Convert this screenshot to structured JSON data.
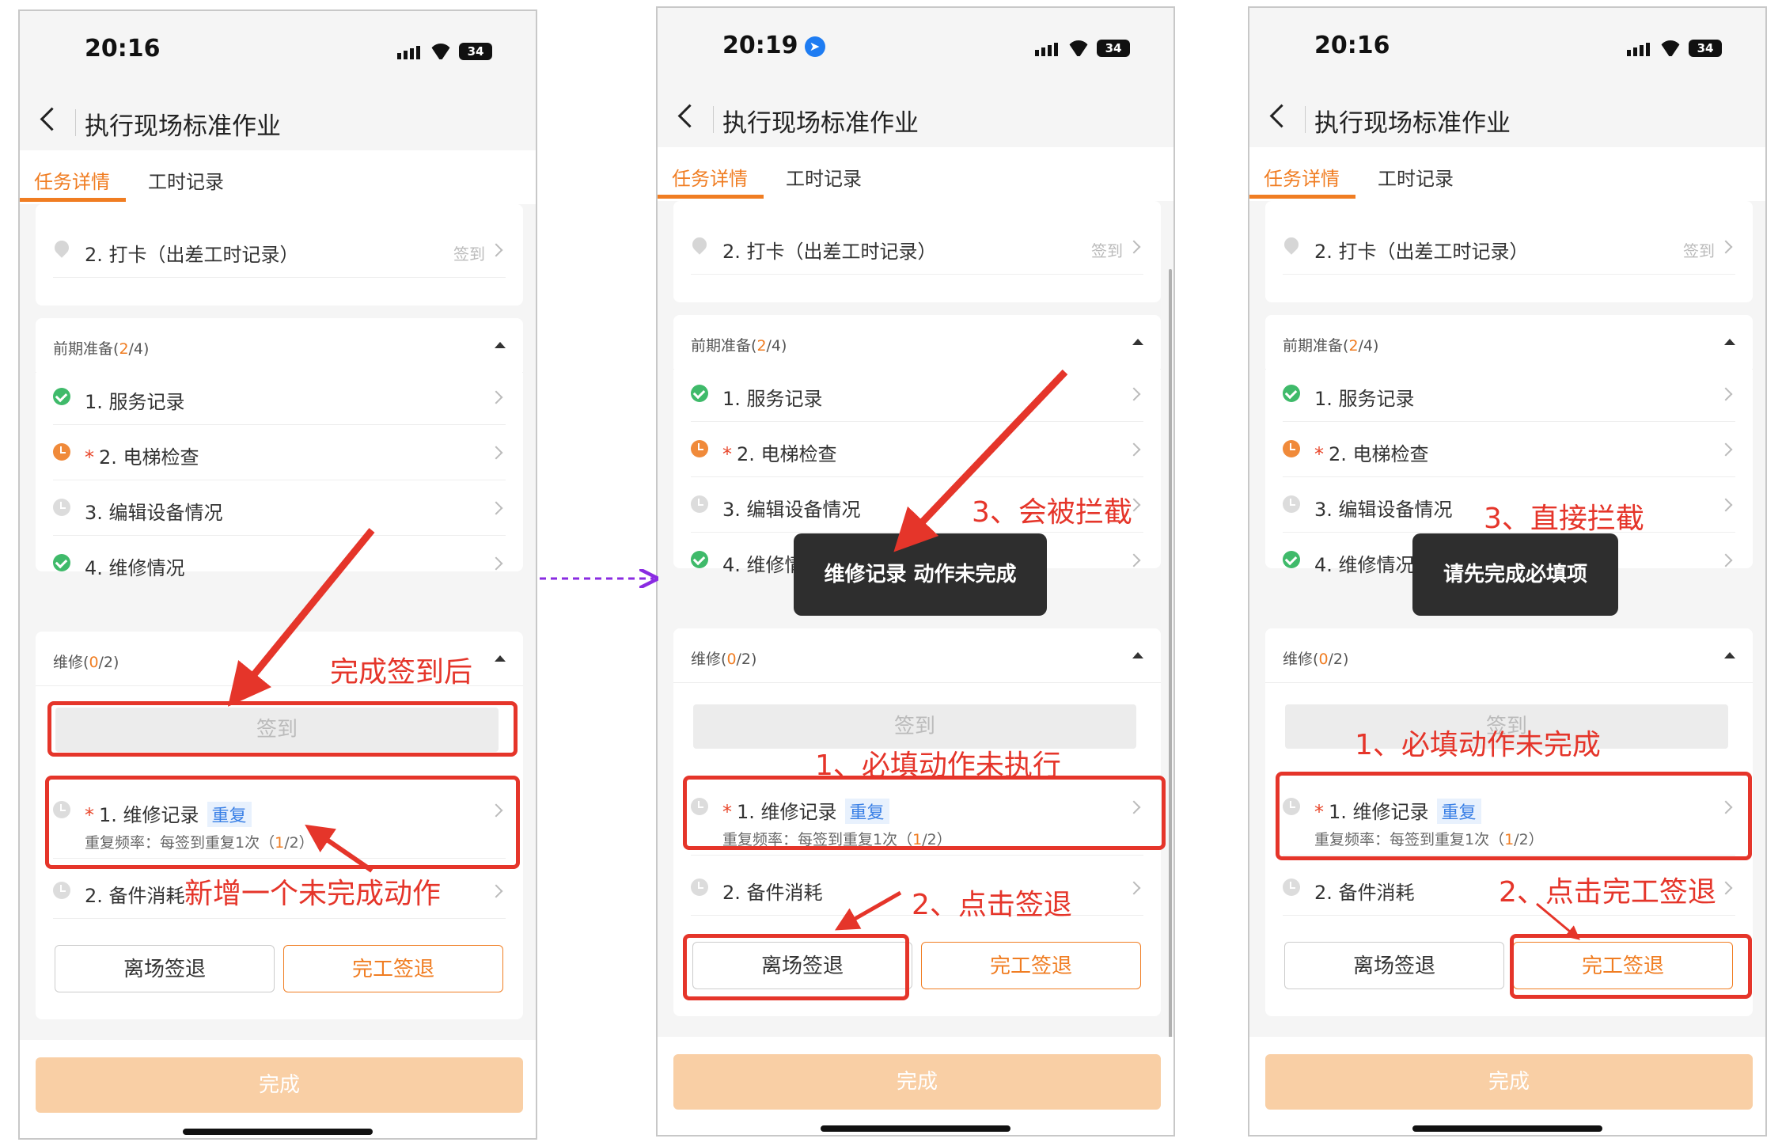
{
  "colors": {
    "accent": "#f07d22",
    "annotation": "#e5352a",
    "done": "#3fba6a",
    "link": "#8a2be2"
  },
  "nav": {
    "title": "执行现场标准作业",
    "back_icon": "chevron-left-icon"
  },
  "tabs": [
    "任务详情",
    "工时记录"
  ],
  "checkin": {
    "label": "2. 打卡（出差工时记录）",
    "action": "签到"
  },
  "prep": {
    "title": "前期准备",
    "count_open": "(",
    "count_done": "2",
    "count_total": "/4)",
    "items": [
      {
        "label": "1. 服务记录",
        "status": "done"
      },
      {
        "label": "2. 电梯检查",
        "status": "in-progress",
        "required": "*"
      },
      {
        "label": "3. 编辑设备情况",
        "status": "todo"
      },
      {
        "label": "4. 维修情况",
        "status": "done"
      }
    ]
  },
  "repair": {
    "title": "维修",
    "count_open": "(",
    "count_done": "0",
    "count_total": "/2)",
    "signin_label": "签到",
    "item1_required": "*",
    "item1_label": "1. 维修记录",
    "item1_tag": "重复",
    "item1_freq": "重复频率：每签到重复1次（",
    "item1_freq_done": "1",
    "item1_freq_total": "/2）",
    "item2_label": "2. 备件消耗",
    "leave_btn": "离场签退",
    "complete_btn": "完工签退"
  },
  "finish_btn": "完成",
  "screens": [
    {
      "time": "20:16",
      "battery": "34"
    },
    {
      "time": "20:19",
      "battery": "34",
      "location_icon": "location-arrow-icon"
    },
    {
      "time": "20:16",
      "battery": "34"
    }
  ],
  "toasts": {
    "screen2": "维修记录 动作未完成",
    "screen3": "请先完成必填项"
  },
  "annotations": {
    "s1_after_signin": "完成签到后",
    "s1_new_action": "新增一个未完成动作",
    "s2_required": "1、必填动作未执行",
    "s2_click": "2、点击签退",
    "s2_blocked": "3、会被拦截",
    "s3_required": "1、必填动作未完成",
    "s3_click": "2、点击完工签退",
    "s3_blocked": "3、直接拦截"
  }
}
